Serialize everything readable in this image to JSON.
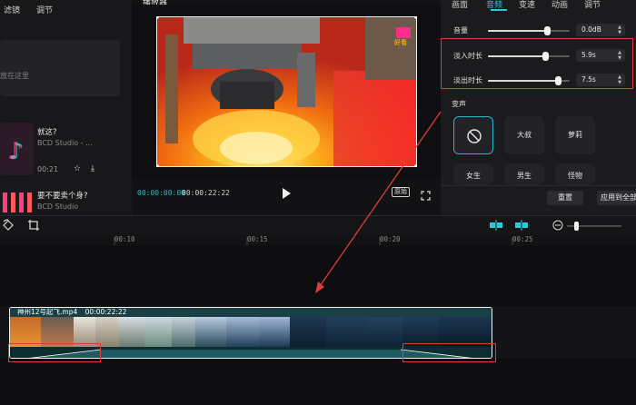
{
  "left_panel": {
    "tabs": [
      "滤镜",
      "调节"
    ],
    "card_hint": "放在这里",
    "media": [
      {
        "title": "就这?",
        "sub": "BCD Studio - ...",
        "time": "00:21"
      },
      {
        "title": "要不要卖个身?",
        "sub": "BCD Studio",
        "time": ""
      }
    ]
  },
  "player": {
    "title": "播放器",
    "watermark": "好看",
    "current_time": "00:00:00:00",
    "total_time": "00:00:22:22",
    "ratio_label": "原始"
  },
  "right_panel": {
    "tabs": [
      "画面",
      "音频",
      "变速",
      "动画",
      "调节"
    ],
    "active_tab": "音频",
    "rows": [
      {
        "label": "音量",
        "value": "0.0dB",
        "level": 0.72
      },
      {
        "label": "淡入时长",
        "value": "5.9s",
        "level": 0.7
      },
      {
        "label": "淡出时长",
        "value": "7.5s",
        "level": 0.85
      }
    ],
    "voice_section": "变声",
    "voices": [
      "",
      "大叔",
      "萝莉"
    ],
    "voices_row2": [
      "女生",
      "男生",
      "怪物"
    ],
    "reset_label": "重置",
    "apply_all_label": "应用到全部"
  },
  "timeline": {
    "ticks": [
      "00:10",
      "00:15",
      "00:20",
      "00:25"
    ],
    "clip_title": "神州12号起飞.mp4",
    "clip_duration": "00:00:22:22"
  },
  "colors": {
    "accent": "#2bc8d8",
    "highlight": "#e03b3b",
    "clip_bg": "#12343a"
  }
}
